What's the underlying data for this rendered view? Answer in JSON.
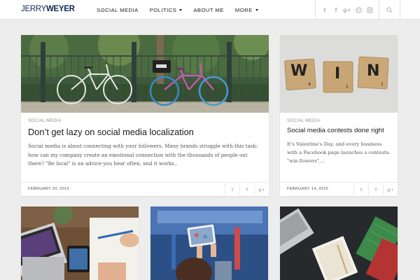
{
  "header": {
    "logo_part1": "JERRY",
    "logo_part2": "WEYER",
    "nav": [
      {
        "label": "SOCIAL MEDIA"
      },
      {
        "label": "POLITICS"
      },
      {
        "label": "ABOUT ME"
      },
      {
        "label": "MORE"
      }
    ],
    "social_icons": [
      {
        "icon": "twitter-icon",
        "glyph": "t"
      },
      {
        "icon": "facebook-icon",
        "glyph": "f"
      },
      {
        "icon": "google-plus-icon",
        "glyph": "g+"
      },
      {
        "icon": "pinterest-icon",
        "glyph": "p"
      },
      {
        "icon": "instagram-icon",
        "glyph": "▣"
      }
    ]
  },
  "posts": [
    {
      "category": "SOCIAL MEDIA",
      "title": "Don’t get lazy on social media localization",
      "excerpt": "Social media is about connecting with your followers. Many brands struggle with this task: how can my company create an emotional connection with the thousands of people out there? \"Be local\" is an advice you hear often, and it works..",
      "date": "FEBRUARY 20, 2015"
    },
    {
      "category": "SOCIAL MEDIA",
      "title": "Social media contests done right",
      "excerpt": "It's Valentine's Day, and every business with a Facebook page launches a contests: \"win flowers\",...",
      "date": "FEBRUARY 14, 2015",
      "tiles": [
        "W",
        "I",
        "N"
      ],
      "tile_numbers": [
        "4",
        "1",
        "1"
      ]
    }
  ],
  "share": {
    "twitter": "t",
    "facebook": "f",
    "google": "g+"
  },
  "colors": {
    "accent": "#0f2a56",
    "background": "#ededed"
  }
}
